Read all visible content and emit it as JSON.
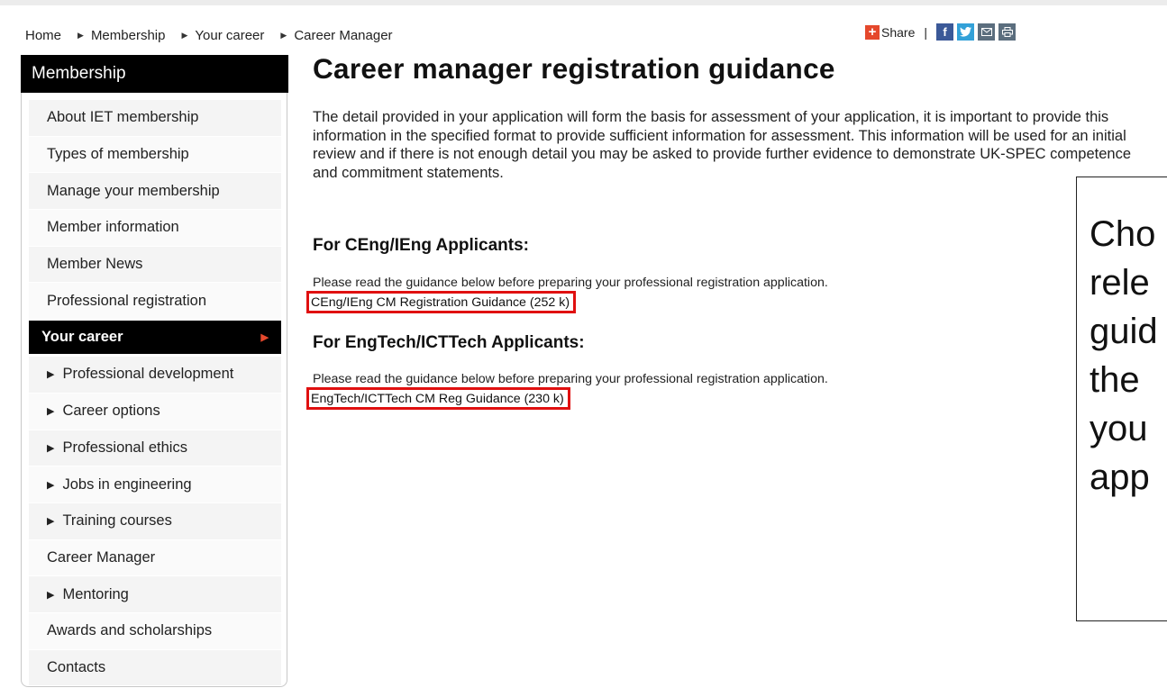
{
  "breadcrumb": {
    "items": [
      "Home",
      "Membership",
      "Your career",
      "Career Manager"
    ]
  },
  "share": {
    "plus_glyph": "+",
    "label": "Share",
    "pipe": "|",
    "icons": [
      "facebook-icon",
      "twitter-icon",
      "email-icon",
      "print-icon"
    ]
  },
  "sidebar": {
    "title": "Membership",
    "items": [
      {
        "label": "About IET membership",
        "type": "top"
      },
      {
        "label": "Types of membership",
        "type": "top"
      },
      {
        "label": "Manage your membership",
        "type": "top"
      },
      {
        "label": "Member information",
        "type": "top"
      },
      {
        "label": "Member News",
        "type": "top"
      },
      {
        "label": "Professional registration",
        "type": "top"
      },
      {
        "label": "Your career",
        "type": "active"
      },
      {
        "label": "Professional development",
        "type": "sub"
      },
      {
        "label": "Career options",
        "type": "sub"
      },
      {
        "label": "Professional ethics",
        "type": "sub"
      },
      {
        "label": "Jobs in engineering",
        "type": "sub"
      },
      {
        "label": "Training courses",
        "type": "sub"
      },
      {
        "label": "Career Manager",
        "type": "top"
      },
      {
        "label": "Mentoring",
        "type": "sub"
      },
      {
        "label": "Awards and scholarships",
        "type": "top"
      },
      {
        "label": "Contacts",
        "type": "top"
      }
    ]
  },
  "main": {
    "title": "Career manager registration guidance",
    "intro": "The detail provided in your application will form the basis for assessment of your application, it is important to provide this information in the specified format to provide sufficient information for assessment.  This information will be used for an initial review and if there is not enough detail you may be asked to provide further evidence to demonstrate UK-SPEC competence and commitment statements.",
    "sections": [
      {
        "heading": "For CEng/IEng Applicants:",
        "note": "Please read the guidance below before preparing your professional registration application.",
        "link": "CEng/IEng CM Registration Guidance (252 k)"
      },
      {
        "heading": "For EngTech/ICTTech Applicants:",
        "note": "Please read the guidance below before preparing your professional registration application.",
        "link": "EngTech/ICTTech CM Reg Guidance (230 k)"
      }
    ]
  },
  "callout": {
    "text": "Cho\nrele\nguid\nthe \nyou\napp"
  },
  "colors": {
    "accent_red": "#e01010",
    "share_orange": "#e5482c",
    "facebook": "#3b5998",
    "twitter": "#33a1d8"
  }
}
